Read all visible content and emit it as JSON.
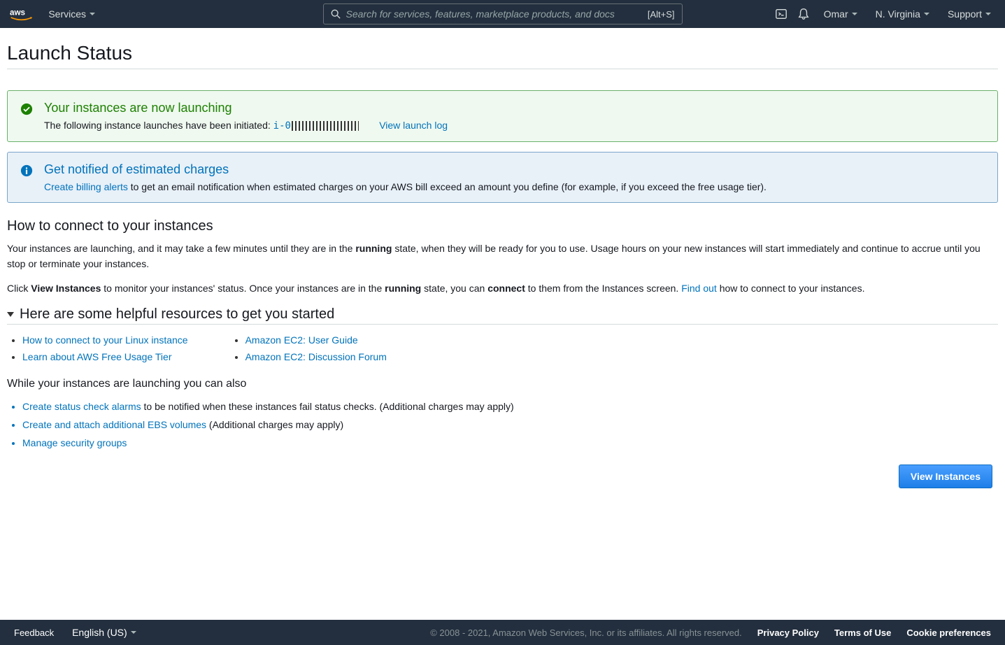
{
  "header": {
    "services": "Services",
    "search_placeholder": "Search for services, features, marketplace products, and docs",
    "search_shortcut": "[Alt+S]",
    "user": "Omar",
    "region": "N. Virginia",
    "support": "Support"
  },
  "page": {
    "title": "Launch Status"
  },
  "alerts": {
    "success": {
      "title": "Your instances are now launching",
      "text": "The following instance launches have been initiated:",
      "instance_prefix": "i-0",
      "view_log": "View launch log"
    },
    "info": {
      "title": "Get notified of estimated charges",
      "link": "Create billing alerts",
      "text": "to get an email notification when estimated charges on your AWS bill exceed an amount you define (for example, if you exceed the free usage tier)."
    }
  },
  "connect": {
    "heading": "How to connect to your instances",
    "p1_a": "Your instances are launching, and it may take a few minutes until they are in the ",
    "p1_b1": "running",
    "p1_c": " state, when they will be ready for you to use. Usage hours on your new instances will start immediately and continue to accrue until you stop or terminate your instances.",
    "p2_a": "Click ",
    "p2_b1": "View Instances",
    "p2_c": " to monitor your instances' status. Once your instances are in the ",
    "p2_b2": "running",
    "p2_d": " state, you can ",
    "p2_b3": "connect",
    "p2_e": " to them from the Instances screen. ",
    "p2_link": "Find out",
    "p2_f": " how to connect to your instances."
  },
  "resources": {
    "heading": "Here are some helpful resources to get you started",
    "col1": [
      "How to connect to your Linux instance",
      "Learn about AWS Free Usage Tier"
    ],
    "col2": [
      "Amazon EC2: User Guide",
      "Amazon EC2: Discussion Forum"
    ]
  },
  "while_launching": {
    "heading": "While your instances are launching you can also",
    "items": [
      {
        "link": "Create status check alarms",
        "text": " to be notified when these instances fail status checks. (Additional charges may apply)"
      },
      {
        "link": "Create and attach additional EBS volumes",
        "text": " (Additional charges may apply)"
      },
      {
        "link": "Manage security groups",
        "text": ""
      }
    ]
  },
  "buttons": {
    "view_instances": "View Instances"
  },
  "footer": {
    "feedback": "Feedback",
    "language": "English (US)",
    "copyright": "© 2008 - 2021, Amazon Web Services, Inc. or its affiliates. All rights reserved.",
    "privacy": "Privacy Policy",
    "terms": "Terms of Use",
    "cookie": "Cookie preferences"
  }
}
